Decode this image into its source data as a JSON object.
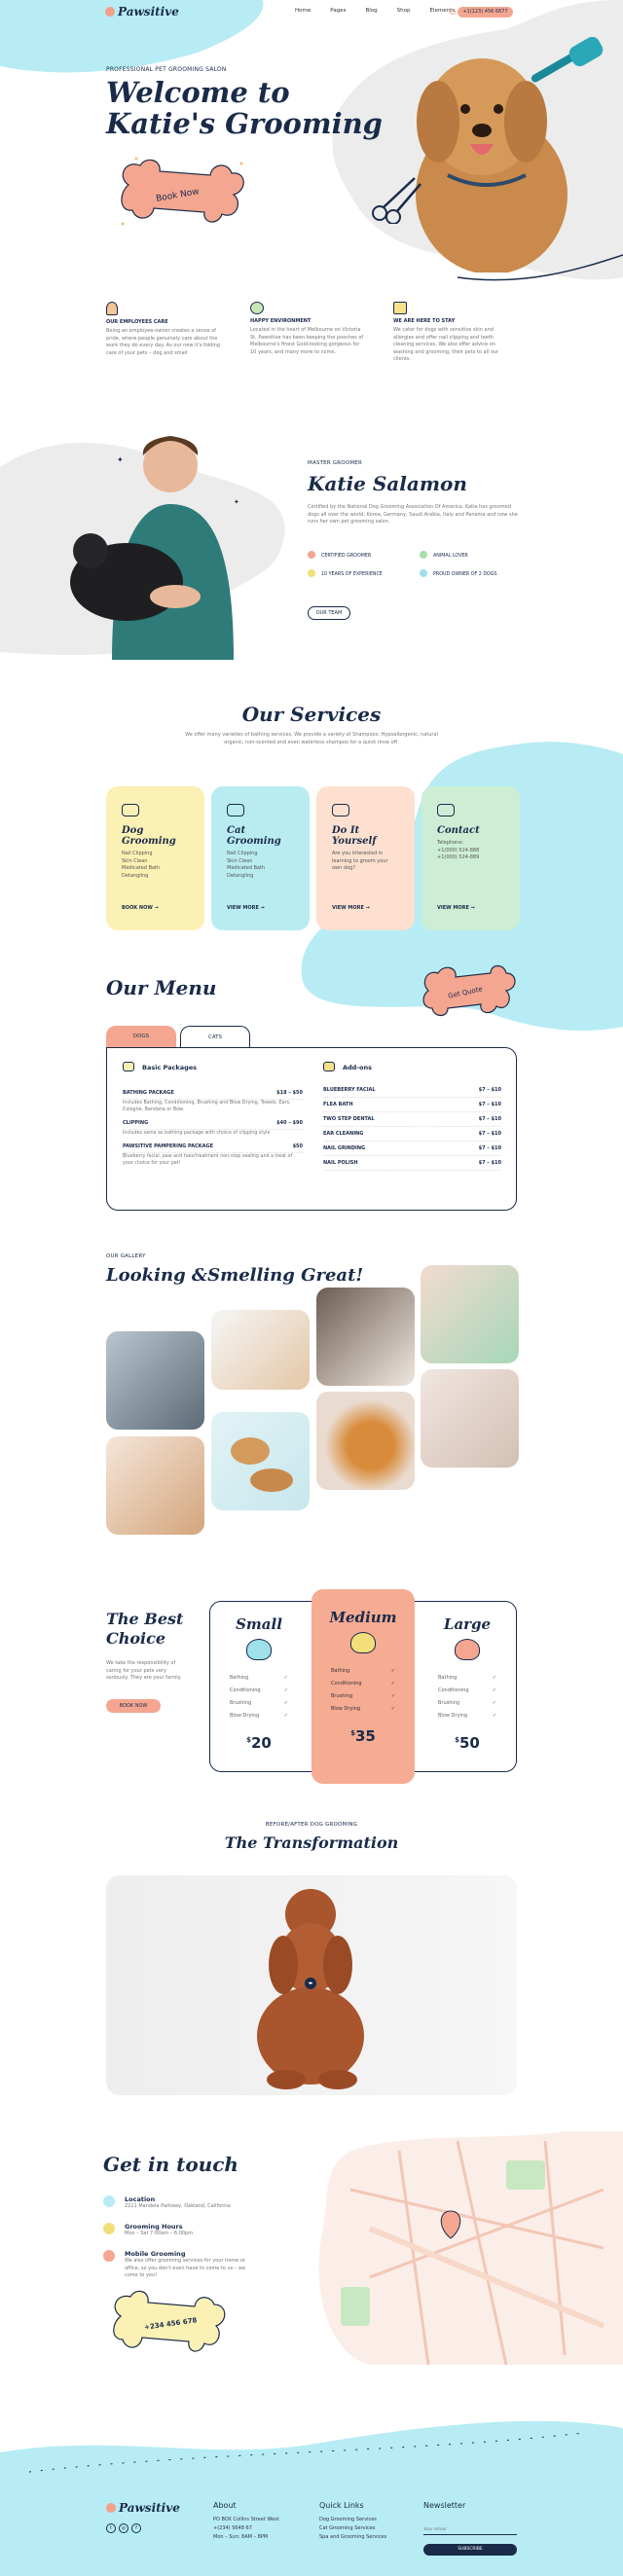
{
  "nav": {
    "logo": "Pawsitive",
    "links": [
      "Home",
      "Pages",
      "Blog",
      "Shop",
      "Elements"
    ],
    "phone": "+1(123) 456 6677"
  },
  "hero": {
    "eyebrow": "PROFESSIONAL PET GROOMING SALON",
    "title_line1": "Welcome to",
    "title_line2": "Katie's Grooming",
    "button": "Book Now"
  },
  "features": [
    {
      "title": "OUR EMPLOYEES CARE",
      "text": "Being an employee-owner creates a sense of pride, where people genuinely care about the work they do every day. As our new it's folding care of your pets – dog and small"
    },
    {
      "title": "HAPPY ENVIRONMENT",
      "text": "Located in the heart of Melbourne on Victoria St, Pawsitive has been keeping the pooches of Melbourne's finest Gold-looking gorgeous for 10 years, and many more to come."
    },
    {
      "title": "WE ARE HERE TO STAY",
      "text": "We cater for dogs with sensitive skin and allergies and offer nail clipping and teeth cleaning services. We also offer advice on washing and grooming, their pets to all our clients."
    }
  ],
  "groomer": {
    "eyebrow": "MASTER GROOMER",
    "name": "Katie Salamon",
    "bio": "Certified by the National Dog Grooming Association Of America. Katie has groomed dogs all over the world: Korea, Germany, Saudi Arabia, Italy and Panama and now she runs her own pet grooming salon.",
    "badges": [
      "CERTIFIED GROOMER",
      "ANIMAL LOVER",
      "10 YEARS OF EXPERIENCE",
      "PROUD OWNER OF 2 DOGS"
    ],
    "button": "OUR TEAM"
  },
  "services": {
    "title": "Our Services",
    "subtitle": "We offer many varieties of bathing services. We provide a variety of Shampoos: Hypoallergenic, natural organic, non-scented and even waterless shampoo for a quick rinse off.",
    "cards": [
      {
        "title": "Dog Grooming",
        "items": [
          "Nail Clipping",
          "Skin Clean",
          "Medicated Bath",
          "Detangling"
        ],
        "link": "BOOK NOW",
        "color": "#fbf1b4"
      },
      {
        "title": "Cat Grooming",
        "items": [
          "Nail Clipping",
          "Skin Clean",
          "Medicated Bath",
          "Detangling"
        ],
        "link": "VIEW MORE",
        "color": "#b9ecf1"
      },
      {
        "title": "Do It Yourself",
        "items": [
          "Are you interested in learning to groom your own dog?"
        ],
        "link": "VIEW MORE",
        "color": "#fde0cf"
      },
      {
        "title": "Contact",
        "items": [
          "Telephone:",
          "+1(000) 524-888",
          "+1(000) 524-889"
        ],
        "link": "VIEW MORE",
        "color": "#cdeed5"
      }
    ]
  },
  "menu": {
    "title": "Our Menu",
    "badge": "Get Quote",
    "tabs": [
      "DOGS",
      "CATS"
    ],
    "basic_title": "Basic Packages",
    "addons_title": "Add-ons",
    "basic": [
      {
        "name": "BATHING PACKAGE",
        "price": "$18 – $50",
        "desc": "Includes Bathing, Conditioning, Brushing and Blow Drying. Towels, Ears, Cologne, Bandana or Bow."
      },
      {
        "name": "CLIPPING",
        "price": "$40 – $90",
        "desc": "Includes same as bathing package with choice of clipping style"
      },
      {
        "name": "PAWSITIVE PAMPERING PACKAGE",
        "price": "$50",
        "desc": "Blueberry facial, paw and toes/treatment non-stop sealing and a treat of your choice for your pet!"
      }
    ],
    "addons": [
      {
        "name": "BLUEBERRY FACIAL",
        "price": "$7 – $10"
      },
      {
        "name": "FLEA BATH",
        "price": "$7 – $10"
      },
      {
        "name": "TWO STEP DENTAL",
        "price": "$7 – $10"
      },
      {
        "name": "EAR CLEANING",
        "price": "$7 – $10"
      },
      {
        "name": "NAIL GRINDING",
        "price": "$7 – $10"
      },
      {
        "name": "NAIL POLISH",
        "price": "$7 – $10"
      }
    ]
  },
  "gallery": {
    "eyebrow": "OUR GALLERY",
    "title": "Looking &Smelling Great!"
  },
  "pricing": {
    "title_line1": "The Best",
    "title_line2": "Choice",
    "text": "We take the responsibility of caring for your pets very seriously. They are your family.",
    "button": "BOOK NOW",
    "plans": [
      {
        "name": "Small",
        "features": [
          "Bathing",
          "Conditioning",
          "Brushing",
          "Blow Drying"
        ],
        "price": "20"
      },
      {
        "name": "Medium",
        "features": [
          "Bathing",
          "Conditioning",
          "Brushing",
          "Blow Drying"
        ],
        "price": "35"
      },
      {
        "name": "Large",
        "features": [
          "Bathing",
          "Conditioning",
          "Brushing",
          "Blow Drying"
        ],
        "price": "50"
      }
    ]
  },
  "transformation": {
    "eyebrow": "BEFORE/AFTER DOG GROOMING",
    "title": "The Transformation"
  },
  "contact": {
    "title": "Get in touch",
    "items": [
      {
        "title": "Location",
        "text": "2211 Mandela Parkway, Oakland, California"
      },
      {
        "title": "Grooming Hours",
        "text": "Mon – Sat 7:00am – 6:00pm"
      },
      {
        "title": "Mobile Grooming",
        "text": "We also offer grooming services for your home or office, so you don't even have to come to us – we come to you!"
      }
    ],
    "phone": "+234 456 678"
  },
  "footer": {
    "logo": "Pawsitive",
    "about_title": "About",
    "about": [
      "PO BOX Collins Street West",
      "+(234) 5648 67",
      "Mon – Sun: 8AM – 8PM"
    ],
    "links_title": "Quick Links",
    "links": [
      "Dog Grooming Services",
      "Cat Grooming Services",
      "Spa and Grooming Services"
    ],
    "newsletter_title": "Newsletter",
    "email_placeholder": "Your email",
    "subscribe": "SUBSCRIBE"
  },
  "colors": {
    "accent": "#f4a690",
    "navy": "#1a2b4a",
    "cyan": "#b7ecf4"
  }
}
